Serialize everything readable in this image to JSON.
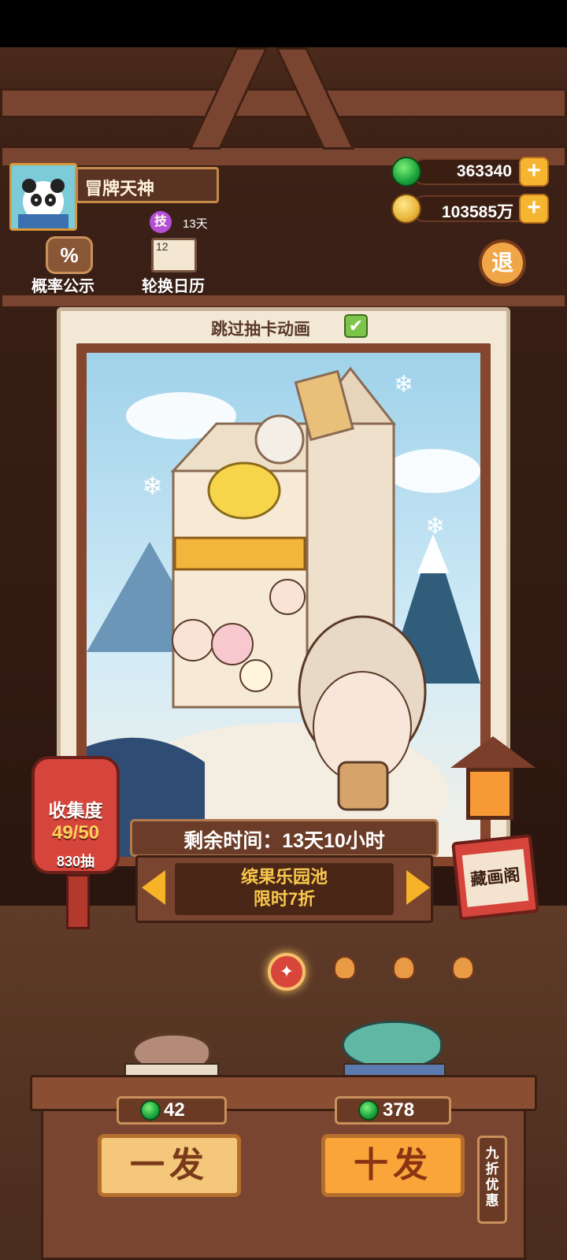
{
  "player": {
    "name": "冒牌天神",
    "skill_badge": "技",
    "skill_days": "13天"
  },
  "currency": {
    "gems": "363340",
    "coins": "103585万",
    "plus_label": "+"
  },
  "toolbar": {
    "rate_icon": "%",
    "rate_label": "概率公示",
    "calendar_icon": "12",
    "calendar_label": "轮换日历",
    "exit_label": "退"
  },
  "gacha": {
    "skip_label": "跳过抽卡动画",
    "skip_checked": "✔",
    "remaining_time": "剩余时间：13天10小时",
    "pool_name": "缤果乐园池",
    "pool_discount": "限时7折"
  },
  "collection": {
    "title": "收集度",
    "count": "49/50",
    "draws": "830抽"
  },
  "gallery_label": "藏画阁",
  "draw": {
    "single_label": "一发",
    "single_cost": "42",
    "ten_label": "十发",
    "ten_cost": "378",
    "discount_tag": "九折优惠"
  },
  "icons": {
    "gem": "green-jade-gem-icon",
    "coin": "copper-coin-icon",
    "active_page": "spark-icon",
    "inactive_page": "lantern-icon"
  },
  "colors": {
    "accent": "#f7b328",
    "lantern_red": "#d6453c",
    "wood": "#7a4530"
  }
}
